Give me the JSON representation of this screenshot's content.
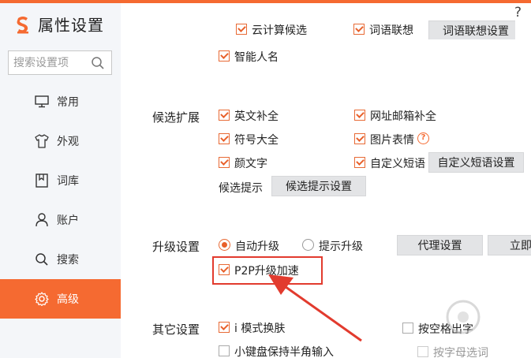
{
  "app": {
    "title": "属性设置"
  },
  "help_label": "?",
  "search": {
    "placeholder": "搜索设置项"
  },
  "sidebar": {
    "items": [
      {
        "label": "常用",
        "icon": "monitor-icon"
      },
      {
        "label": "外观",
        "icon": "shirt-icon"
      },
      {
        "label": "词库",
        "icon": "book-icon"
      },
      {
        "label": "账户",
        "icon": "user-icon"
      },
      {
        "label": "搜索",
        "icon": "search-icon"
      },
      {
        "label": "高级",
        "icon": "gear-icon",
        "active": true
      }
    ]
  },
  "top_partial": {
    "cloud_label": "云计算候选",
    "lexicon_label": "词语联想",
    "lexicon_button": "词语联想设置",
    "smart_name_label": "智能人名"
  },
  "candidate_ext": {
    "section": "候选扩展",
    "english": "英文补全",
    "url_email": "网址邮箱补全",
    "symbols": "符号大全",
    "emoji_images": "图片表情",
    "kaomoji": "颜文字",
    "custom_phrases": "自定义短语",
    "custom_phrases_button": "自定义短语设置",
    "hint_label": "候选提示",
    "hint_button": "候选提示设置"
  },
  "upgrade": {
    "section": "升级设置",
    "auto": "自动升级",
    "prompt": "提示升级",
    "proxy_button": "代理设置",
    "now_button": "立即",
    "p2p": "P2P升级加速"
  },
  "other": {
    "section": "其它设置",
    "imode": "i 模式换肤",
    "keyboard_half": "小键盘保持半角输入",
    "esc_exit": "按空格出字",
    "letter_select": "按字母选词"
  },
  "colors": {
    "accent": "#f56a31",
    "annotation": "#e23b2e"
  }
}
